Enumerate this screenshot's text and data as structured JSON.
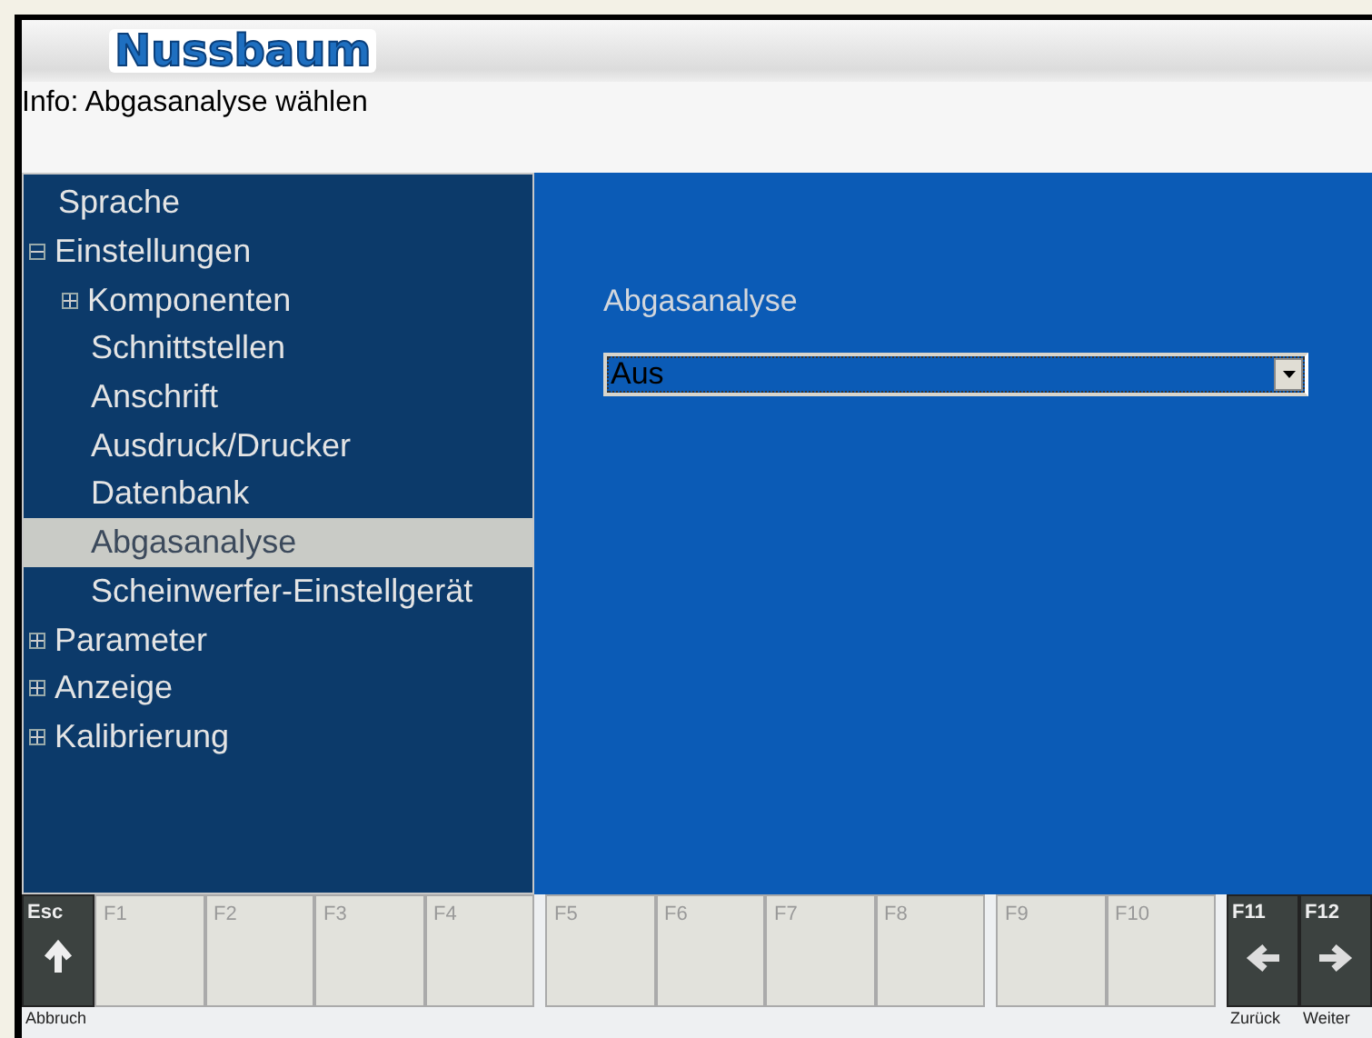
{
  "header": {
    "logo": "Nussbaum",
    "info": "Info: Abgasanalyse wählen"
  },
  "tree": [
    {
      "label": "Sprache",
      "selected": false
    },
    {
      "label": "Einstellungen",
      "selected": false,
      "expanded": true,
      "children": [
        {
          "label": "Komponenten",
          "selected": false,
          "expanded": false
        },
        {
          "label": "Schnittstellen",
          "selected": false
        },
        {
          "label": "Anschrift",
          "selected": false
        },
        {
          "label": "Ausdruck/Drucker",
          "selected": false
        },
        {
          "label": "Datenbank",
          "selected": false
        },
        {
          "label": "Abgasanalyse",
          "selected": true
        },
        {
          "label": "Scheinwerfer-Einstellgerät",
          "selected": false
        }
      ]
    },
    {
      "label": "Parameter",
      "selected": false,
      "expanded": false
    },
    {
      "label": "Anzeige",
      "selected": false,
      "expanded": false
    },
    {
      "label": "Kalibrierung",
      "selected": false,
      "expanded": false
    }
  ],
  "panel": {
    "label": "Abgasanalyse",
    "value": "Aus"
  },
  "function_keys": [
    {
      "key": "Esc",
      "kind": "up",
      "caption": "Abbruch"
    },
    {
      "key": "F1",
      "kind": "plain"
    },
    {
      "key": "F2",
      "kind": "plain"
    },
    {
      "key": "F3",
      "kind": "plain"
    },
    {
      "key": "F4",
      "kind": "plain"
    },
    {
      "key": "F5",
      "kind": "plain"
    },
    {
      "key": "F6",
      "kind": "plain"
    },
    {
      "key": "F7",
      "kind": "plain"
    },
    {
      "key": "F8",
      "kind": "plain"
    },
    {
      "key": "F9",
      "kind": "plain"
    },
    {
      "key": "F10",
      "kind": "plain"
    },
    {
      "key": "F11",
      "kind": "left",
      "caption": "Zurück"
    },
    {
      "key": "F12",
      "kind": "right",
      "caption": "Weiter"
    }
  ]
}
